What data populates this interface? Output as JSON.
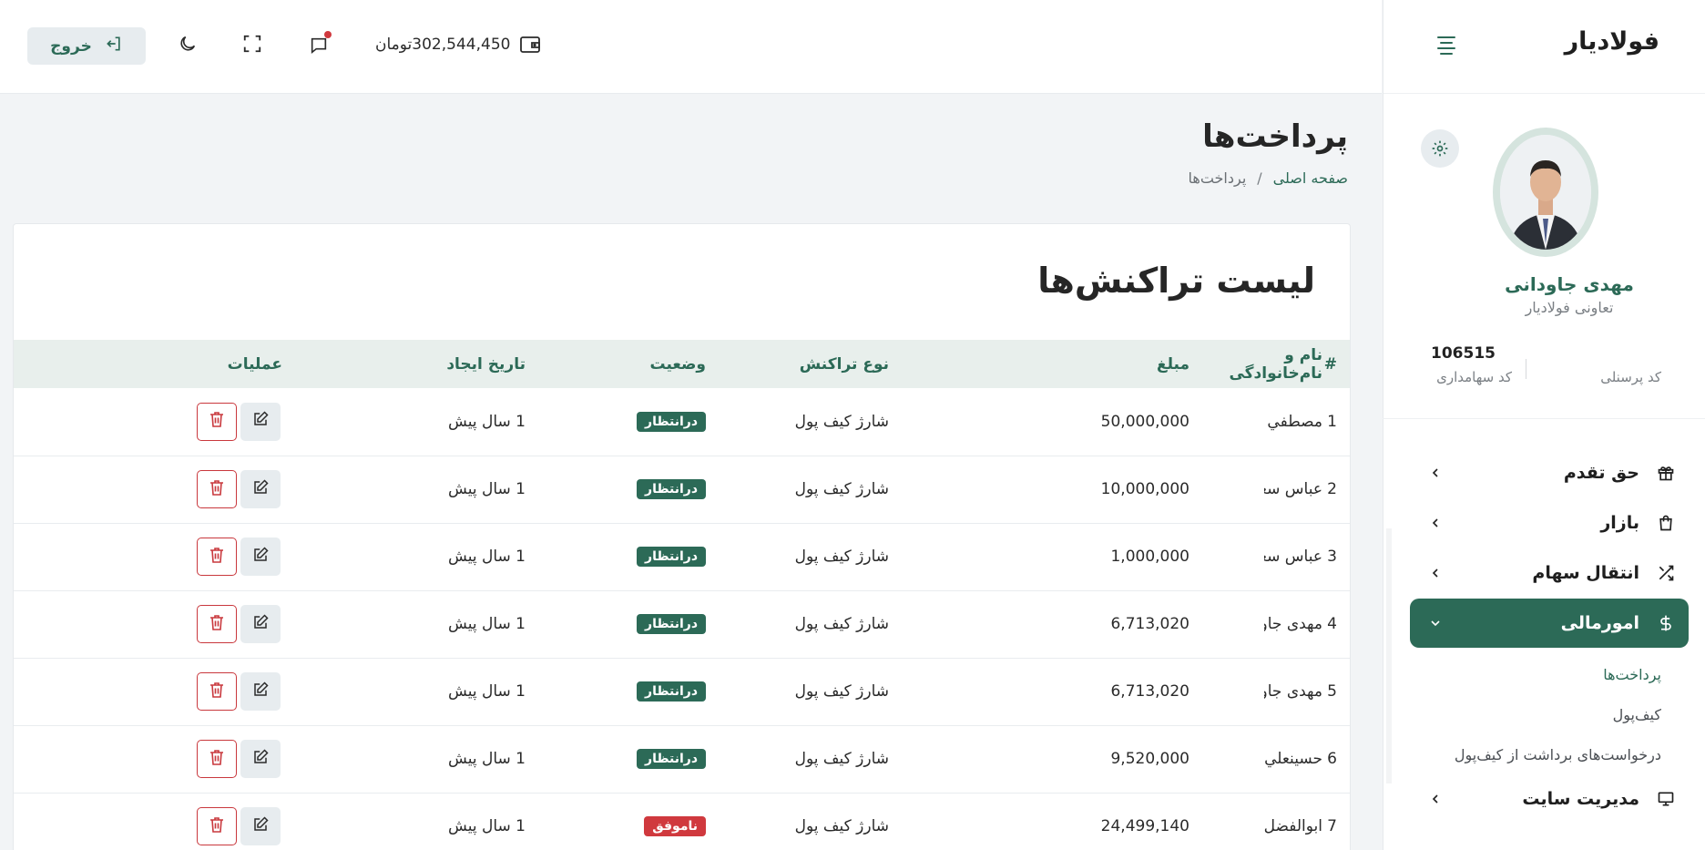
{
  "sidebar": {
    "brand": "فولادیار",
    "profile": {
      "name": "مهدی جاودانی",
      "org": "تعاونی فولادیار",
      "personnel_label": "کد پرسنلی",
      "share_value": "106515",
      "share_label": "کد سهامداری"
    },
    "nav": [
      {
        "label": "حق تقدم",
        "icon": "gift-icon"
      },
      {
        "label": "بازار",
        "icon": "bag-icon"
      },
      {
        "label": "انتقال سهام",
        "icon": "shuffle-icon"
      },
      {
        "label": "امورمالی",
        "icon": "dollar-icon",
        "active": true
      },
      {
        "label": "مدیریت سایت",
        "icon": "monitor-icon"
      }
    ],
    "sub": [
      "پرداخت‌ها",
      "کیف‌پول",
      "درخواست‌های برداشت از کیف‌پول"
    ]
  },
  "topbar": {
    "exit_label": "خروج",
    "wallet_amount": "302,544,450",
    "wallet_unit": "تومان"
  },
  "page": {
    "title": "پرداخت‌ها",
    "breadcrumb_home": "صفحه اصلی",
    "breadcrumb_sep": "/",
    "breadcrumb_current": "پرداخت‌ها",
    "card_title": "لیست تراکنش‌ها"
  },
  "table": {
    "headers": [
      "#",
      "نام و نام‌خانوادگی",
      "مبلغ",
      "نوع تراکنش",
      "وضعیت",
      "تاریخ ایجاد",
      "عملیات"
    ],
    "rows": [
      {
        "n": "1",
        "name": "مصطفي ر",
        "amount": "50,000,000",
        "type": "شارژ كيف پول",
        "status": "درانتظار",
        "date": "1 سال پیش"
      },
      {
        "n": "2",
        "name": "عباس سعـ",
        "amount": "10,000,000",
        "type": "شارژ كيف پول",
        "status": "درانتظار",
        "date": "1 سال پیش"
      },
      {
        "n": "3",
        "name": "عباس سعـ",
        "amount": "1,000,000",
        "type": "شارژ كيف پول",
        "status": "درانتظار",
        "date": "1 سال پیش"
      },
      {
        "n": "4",
        "name": "مهدی جاو",
        "amount": "6,713,020",
        "type": "شارژ كيف پول",
        "status": "درانتظار",
        "date": "1 سال پیش"
      },
      {
        "n": "5",
        "name": "مهدی جاو",
        "amount": "6,713,020",
        "type": "شارژ كيف پول",
        "status": "درانتظار",
        "date": "1 سال پیش"
      },
      {
        "n": "6",
        "name": "حسينعلي",
        "amount": "9,520,000",
        "type": "شارژ كيف پول",
        "status": "درانتظار",
        "date": "1 سال پیش"
      },
      {
        "n": "7",
        "name": "ابوالفضل",
        "amount": "24,499,140",
        "type": "شارژ كيف پول",
        "status": "ناموفق",
        "date": "1 سال پیش"
      }
    ]
  },
  "colors": {
    "accent": "#2c6a57",
    "danger": "#d0393e",
    "header_bg": "#e8efec"
  }
}
